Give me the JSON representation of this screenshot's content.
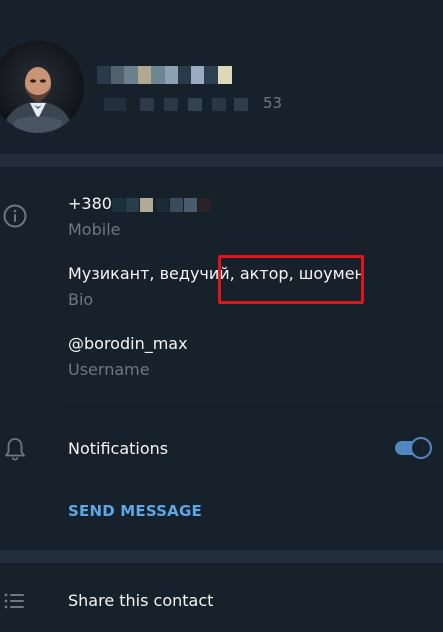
{
  "profile": {
    "name_blur_colors": [
      "#2a3a4a",
      "#53606d",
      "#6b7f8c",
      "#b3a88f",
      "#6d8790",
      "#8ea0b4",
      "#2b3a48",
      "#9aaac0",
      "#2e3f53",
      "#dcd8b8"
    ],
    "status_suffix": "53"
  },
  "info": {
    "phone_prefix": "+380",
    "phone_blur_colors": [
      "#18313a",
      "#2a3d4a",
      "#b0aa98",
      "#1c2a36",
      "#3a4b5c",
      "#4a5b6c",
      "#2a2226"
    ],
    "phone_label": "Mobile",
    "bio_text": "Музикант, ведучий, актор, шоумен",
    "bio_label": "Bio",
    "username": "@borodin_max",
    "username_label": "Username"
  },
  "notifications": {
    "label": "Notifications",
    "enabled": true
  },
  "actions": {
    "send_message": "SEND MESSAGE",
    "share_contact": "Share this contact"
  },
  "colors": {
    "background": "#17212b",
    "separator": "#232e3c",
    "accent": "#5288c1",
    "link": "#5ca7e8",
    "secondary_text": "#6c7883",
    "highlight": "#e0151a"
  },
  "icons": {
    "info": "info-icon",
    "notifications": "bell-icon",
    "share": "list-icon"
  }
}
